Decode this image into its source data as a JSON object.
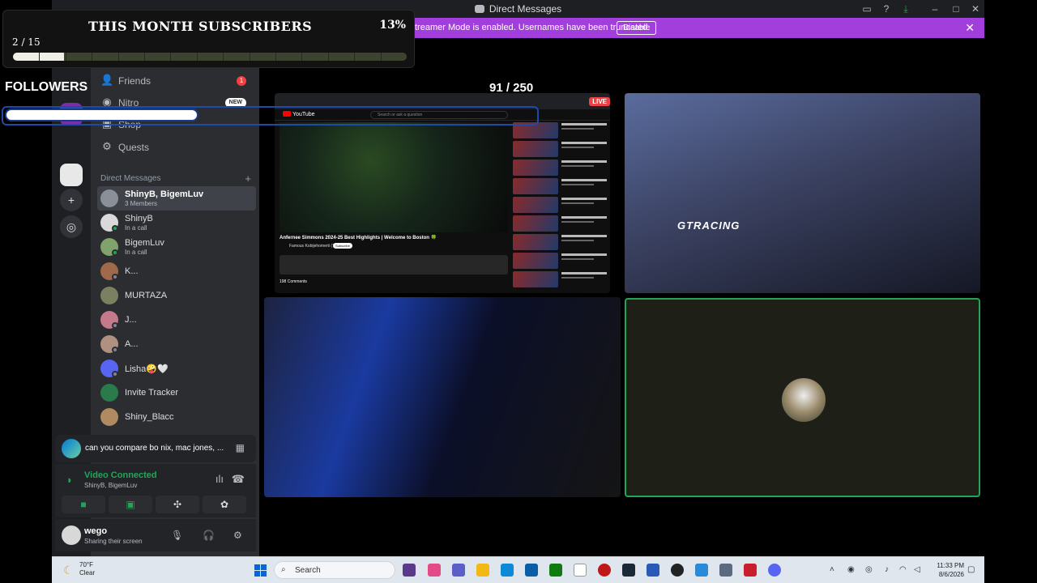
{
  "window": {
    "title": "Direct Messages"
  },
  "banner": {
    "text": "treamer Mode is enabled. Usernames have been truncated.",
    "button": "Disable",
    "close": "✕"
  },
  "nav": {
    "friends": "Friends",
    "friends_badge": "1",
    "nitro": "Nitro",
    "nitro_badge": "NEW",
    "shop": "Shop",
    "quests": "Quests"
  },
  "dm_header": "Direct Messages",
  "dms": [
    {
      "name": "ShinyB, BigemLuv",
      "sub": "3 Members"
    },
    {
      "name": "ShinyB",
      "sub": "In a call"
    },
    {
      "name": "BigemLuv",
      "sub": "In a call"
    },
    {
      "name": "K..."
    },
    {
      "name": "MURTAZA"
    },
    {
      "name": "J..."
    },
    {
      "name": "A..."
    },
    {
      "name": "Lisha🤪🤍"
    },
    {
      "name": "Invite Tracker"
    },
    {
      "name": "Shiny_Blacc"
    }
  ],
  "activity": {
    "text": "can you compare bo nix, mac jones, ..."
  },
  "voice": {
    "status": "Video Connected",
    "channel": "ShinyB, BigemLuv"
  },
  "user": {
    "name": "wego",
    "status": "Sharing their screen"
  },
  "call": {
    "participant_count": "91 / 250",
    "live_badge": "LIVE",
    "cam_text": "GTRACING"
  },
  "youtube": {
    "logo": "YouTube",
    "search": "Search or ask a question",
    "video_title": "Anfernee Simmons 2024-25 Best Highlights | Welcome to Boston 🍀",
    "channel": "Famous Kobijehomerti (Tim)",
    "subscribe": "Subscribe",
    "comments": "198 Comments"
  },
  "sub_widget": {
    "title": "THIS MONTH SUBSCRIBERS",
    "percent": "13%",
    "count": "2 / 15",
    "progress": 0.13
  },
  "followers": {
    "label": "FOLLOWERS"
  },
  "taskbar": {
    "temp": "70°F",
    "weather": "Clear",
    "search": "Search",
    "time": "11:33 PM",
    "date": "8/6/2026"
  },
  "colors": {
    "banner": "#a23fdc",
    "connected": "#23a559",
    "sidebar": "#2b2d31",
    "rail": "#1e1f22",
    "tile_border_active": "#23a559",
    "live": "#ed4245"
  }
}
